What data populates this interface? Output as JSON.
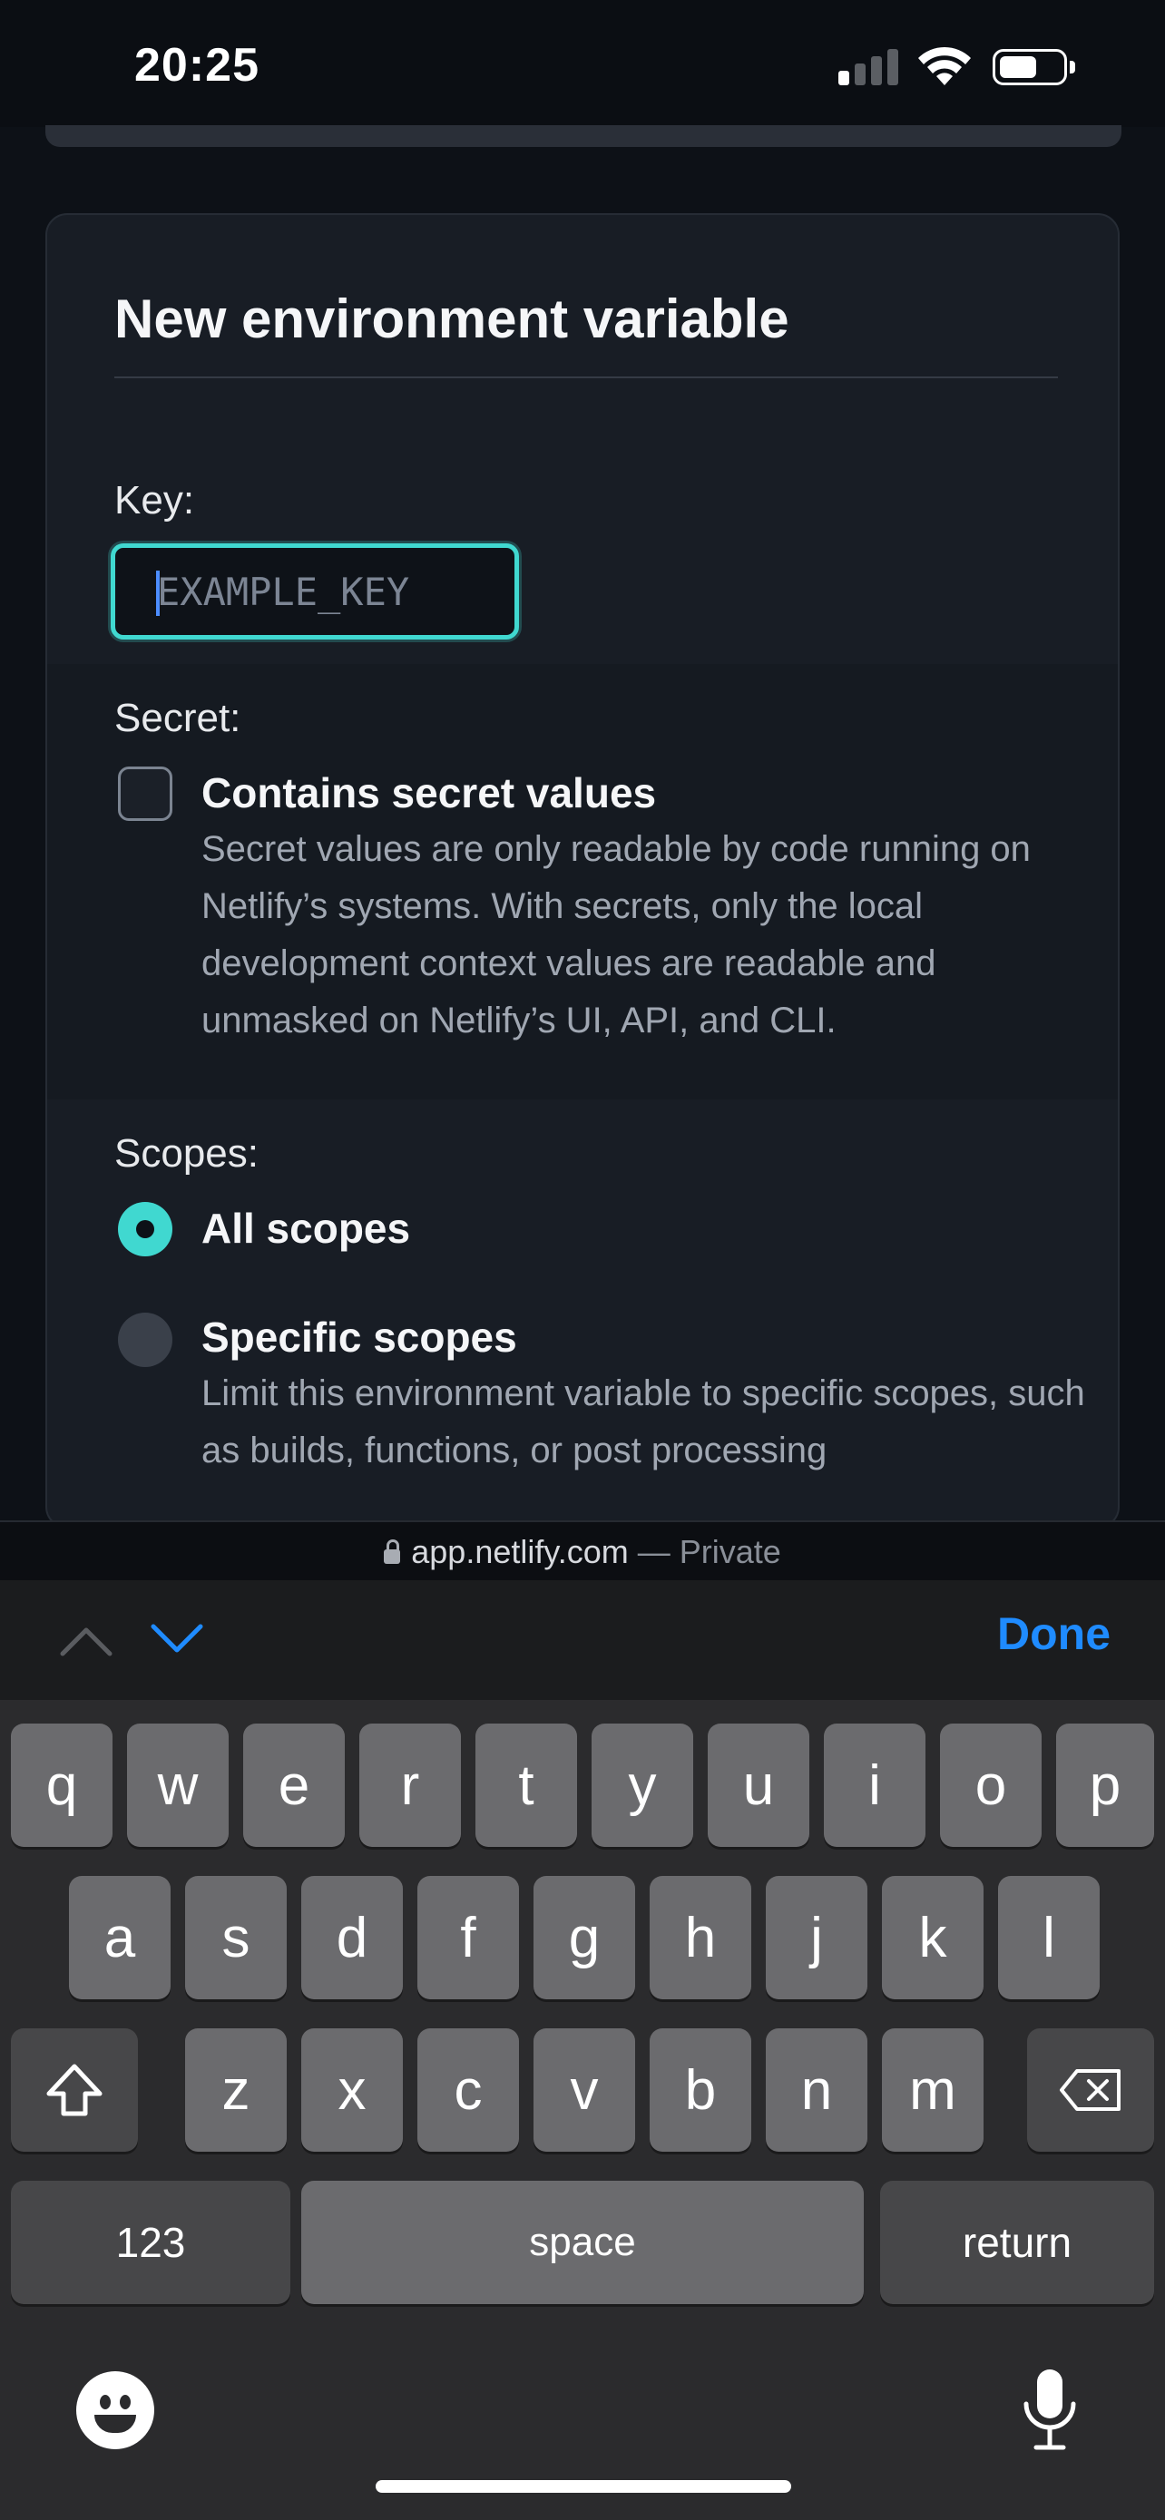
{
  "status_bar": {
    "time": "20:25"
  },
  "form": {
    "title": "New environment variable",
    "key_label": "Key:",
    "key_placeholder": "EXAMPLE_KEY",
    "key_value": "",
    "secret_label": "Secret:",
    "secret_checkbox": {
      "title": "Contains secret values",
      "description": "Secret values are only readable by code running on Netlify’s systems. With secrets, only the local development context values are readable and unmasked on Netlify’s UI, API, and CLI.",
      "checked": false
    },
    "scopes_label": "Scopes:",
    "scopes": [
      {
        "title": "All scopes",
        "selected": true
      },
      {
        "title": "Specific scopes",
        "description": "Limit this environment variable to specific scopes, such as builds, functions, or post processing",
        "selected": false
      }
    ]
  },
  "browser": {
    "domain": "app.netlify.com",
    "mode": " — Private"
  },
  "accessory_bar": {
    "done_label": "Done"
  },
  "keyboard": {
    "row1": [
      "q",
      "w",
      "e",
      "r",
      "t",
      "y",
      "u",
      "i",
      "o",
      "p"
    ],
    "row2": [
      "a",
      "s",
      "d",
      "f",
      "g",
      "h",
      "j",
      "k",
      "l"
    ],
    "row3": [
      "z",
      "x",
      "c",
      "v",
      "b",
      "n",
      "m"
    ],
    "numbers_label": "123",
    "space_label": "space",
    "return_label": "return"
  },
  "colors": {
    "accent": "#40d8d0",
    "done_blue": "#1f8bff",
    "card_bg": "#181d25"
  }
}
